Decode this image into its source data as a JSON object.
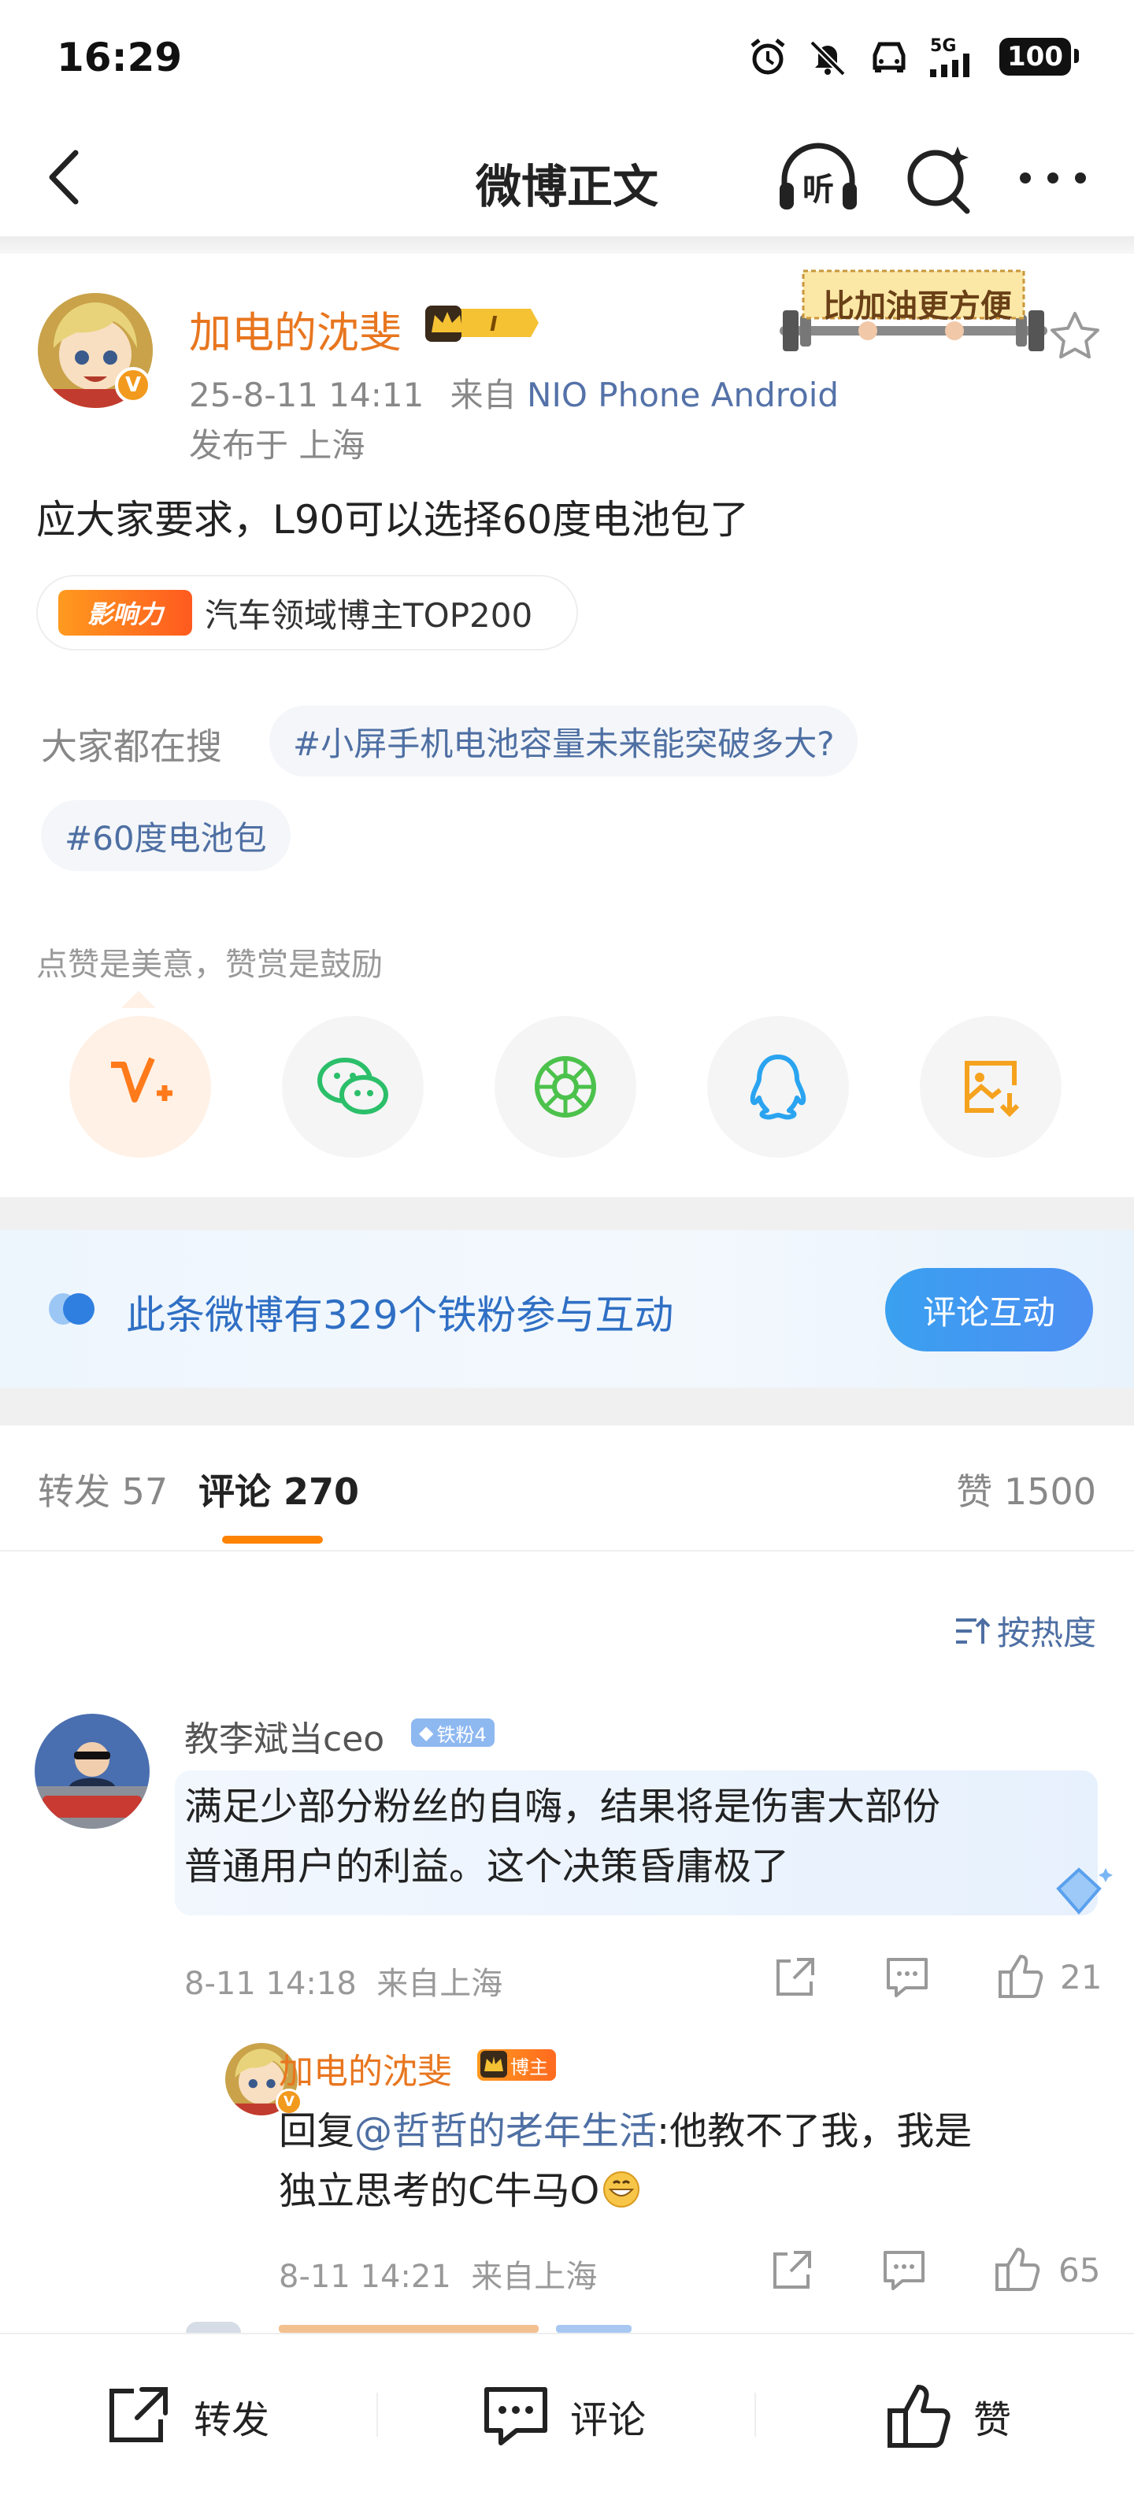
{
  "status_bar": {
    "time": "16:29",
    "network": "5G",
    "battery": "100"
  },
  "nav": {
    "title": "微博正文"
  },
  "post": {
    "author": "加电的沈斐",
    "time": "25-8-11 14:11",
    "source_prefix": "来自",
    "source": "NIO Phone Android",
    "location": "发布于 上海",
    "sticker_text": "比加油更方便",
    "text": "应大家要求，L90可以选择60度电池包了",
    "influence_badge": "影响力",
    "influence_text": "汽车领域博主TOP200",
    "search_label": "大家都在搜",
    "hashtags": [
      "#小屏手机电池容量未来能突破多大?",
      "#60度电池包"
    ],
    "reward_text": "点赞是美意，赞赏是鼓励",
    "share_targets": [
      "v-plus-icon",
      "wechat-icon",
      "moments-icon",
      "qq-icon",
      "save-image-icon"
    ]
  },
  "fans_banner": {
    "text": "此条微博有329个铁粉参与互动",
    "button": "评论互动"
  },
  "tabs": {
    "repost": "转发 57",
    "comments": "评论 270",
    "likes": "赞 1500"
  },
  "sort": {
    "label": "按热度"
  },
  "comments": [
    {
      "name": "教李斌当ceo",
      "badge": "铁粉4",
      "text_line1": "满足少部分粉丝的自嗨，结果将是伤害大部份",
      "text_line2": "普通用户的利益。这个决策昏庸极了",
      "time": "8-11 14:18  来自上海",
      "likes": "21"
    },
    {
      "name": "加电的沈斐",
      "badge": "博主",
      "reply_prefix": "回复",
      "mention": "@哲哲的老年生活",
      "text_line1_rest": ":他教不了我，我是",
      "text_line2": "独立思考的C牛马O",
      "time": "8-11 14:21  来自上海",
      "likes": "65"
    }
  ],
  "bottom_bar": {
    "repost": "转发",
    "comment": "评论",
    "like": "赞"
  },
  "colors": {
    "accent": "#ff8200",
    "link": "#4e6fa3",
    "author": "#e8761f",
    "fans_blue": "#2f6fc4"
  }
}
